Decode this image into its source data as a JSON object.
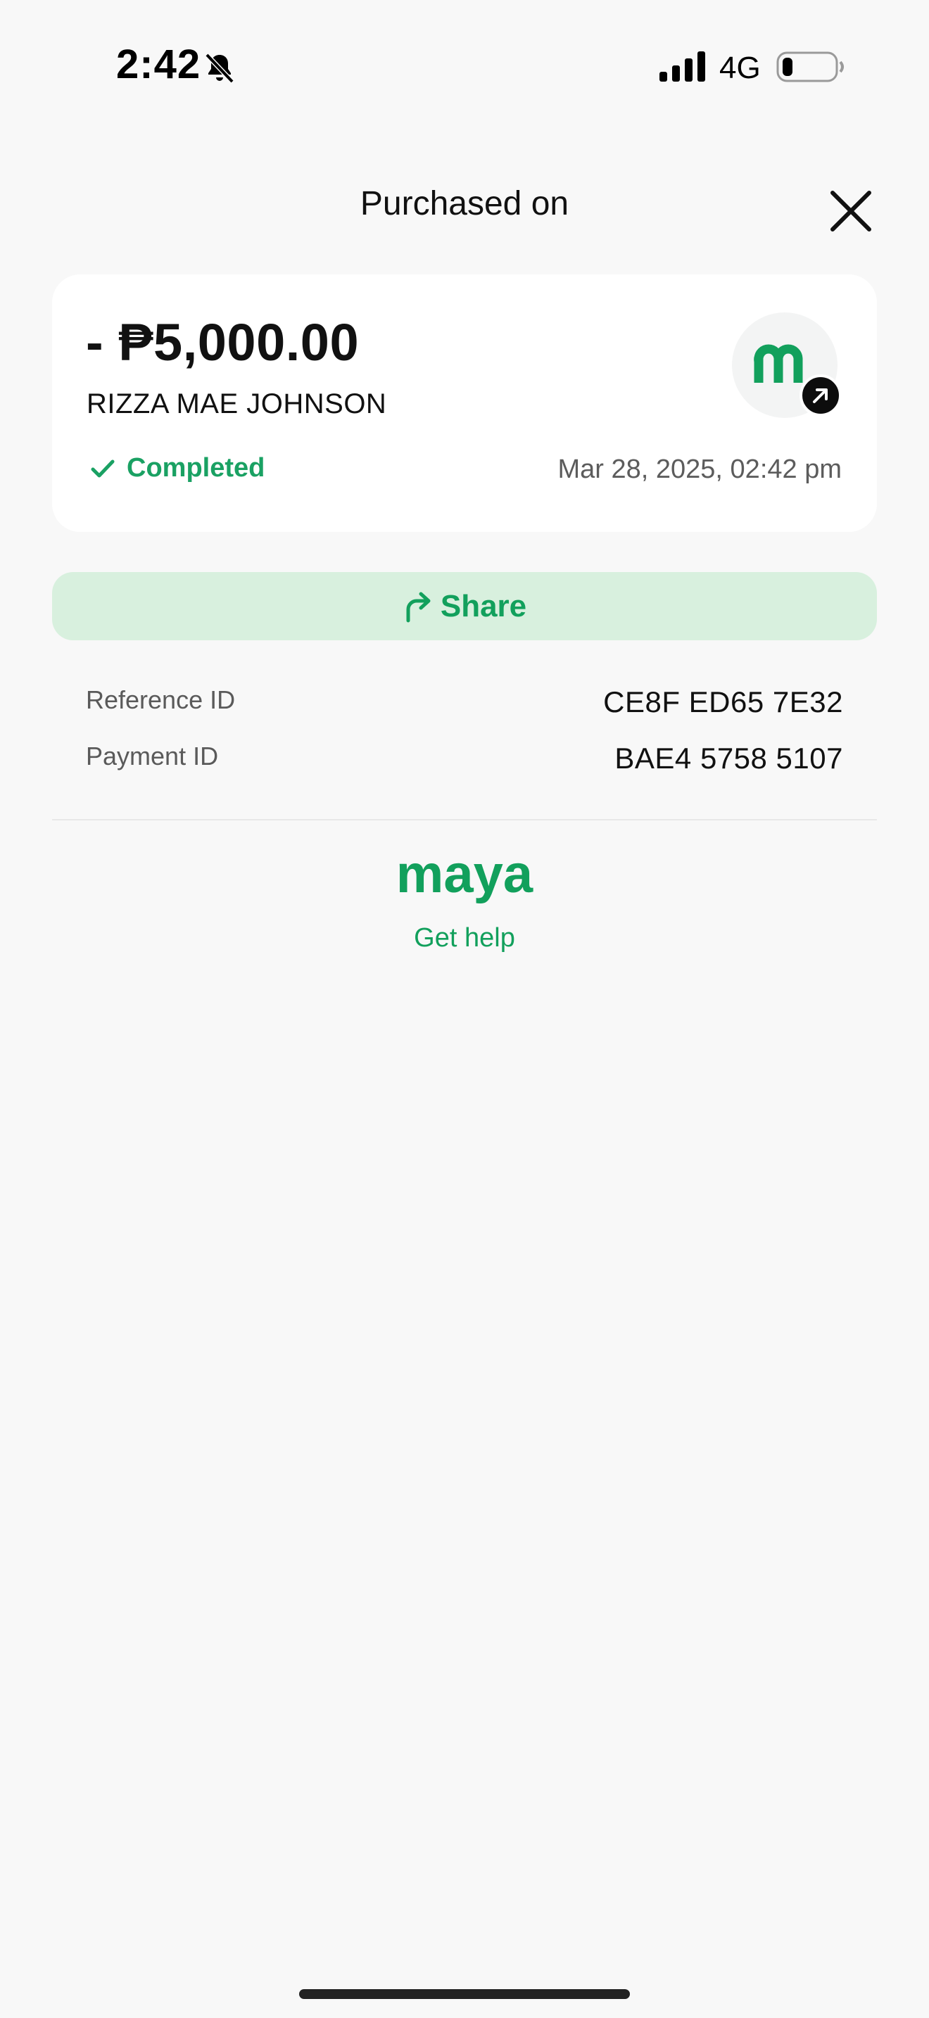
{
  "status_bar": {
    "time": "2:42",
    "network": "4G"
  },
  "header": {
    "title": "Purchased on"
  },
  "transaction": {
    "amount": "- ₱5,000.00",
    "payee": "RIZZA MAE JOHNSON",
    "status": "Completed",
    "datetime": "Mar 28, 2025, 02:42 pm"
  },
  "actions": {
    "share_label": "Share"
  },
  "details": [
    {
      "label": "Reference ID",
      "value": "CE8F ED65 7E32"
    },
    {
      "label": "Payment ID",
      "value": "BAE4 5758 5107"
    }
  ],
  "footer": {
    "brand": "maya",
    "help_label": "Get help"
  },
  "colors": {
    "accent": "#12a05c",
    "share_bg": "#d8f0de",
    "background": "#f8f8f8"
  }
}
